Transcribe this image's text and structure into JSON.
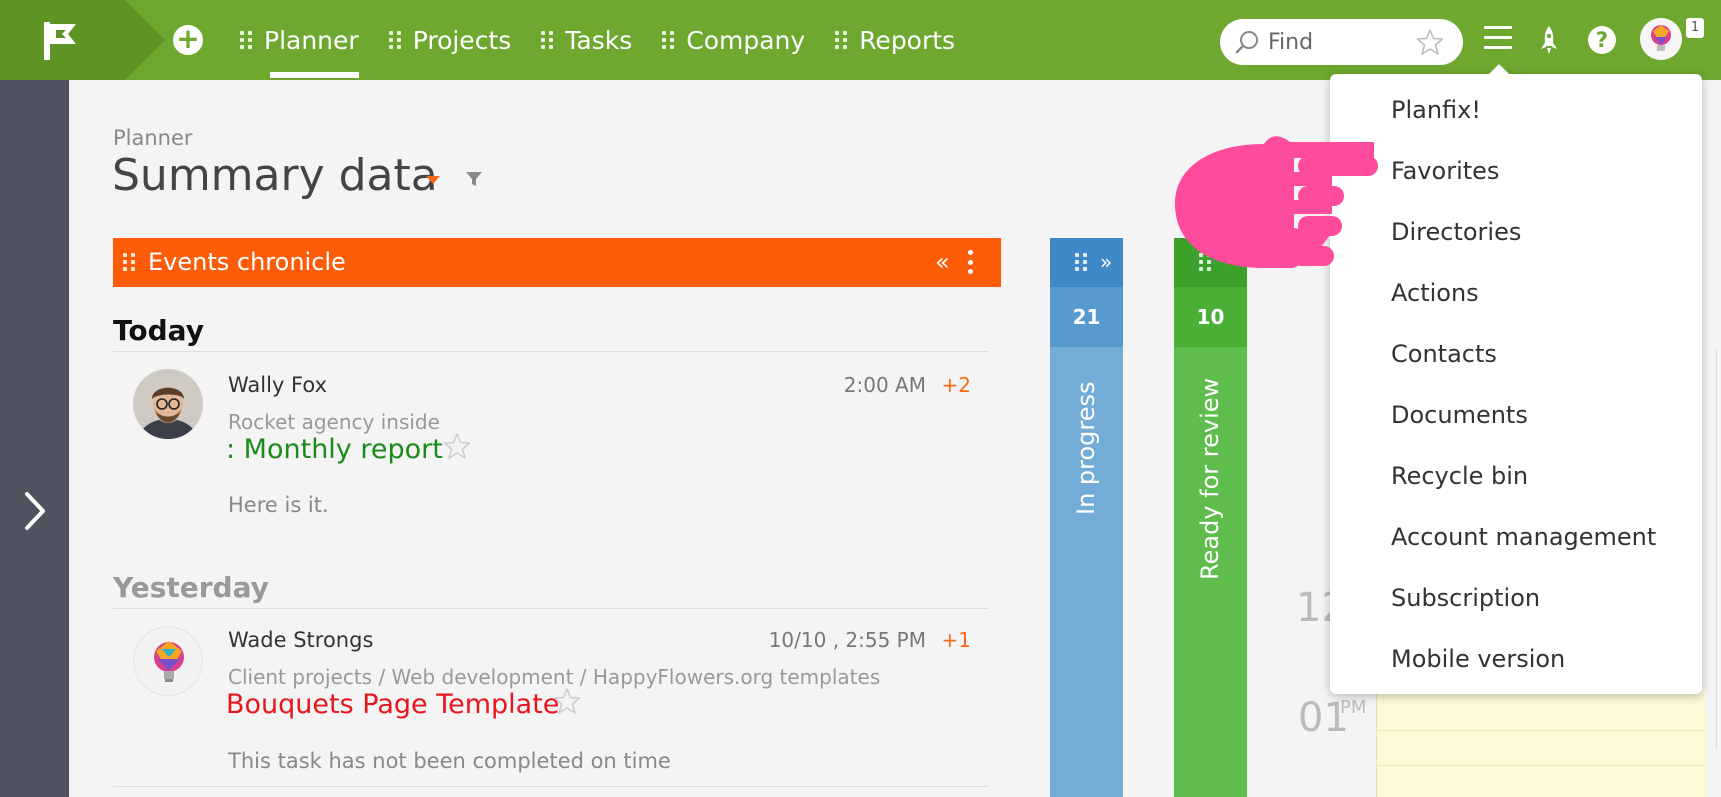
{
  "topbar": {
    "nav": [
      "Planner",
      "Projects",
      "Tasks",
      "Company",
      "Reports"
    ],
    "active_nav": "Planner",
    "search_placeholder": "Find",
    "notification_count": "1"
  },
  "page": {
    "breadcrumb": "Planner",
    "title": "Summary data"
  },
  "events_panel": {
    "title": "Events chronicle",
    "collapse_glyph": "«",
    "today_heading": "Today",
    "yesterday_heading": "Yesterday",
    "events": [
      {
        "author": "Wally Fox",
        "time": "2:00 AM",
        "plus": "+2",
        "project": "Rocket agency inside",
        "task": ": Monthly report",
        "task_color": "#1a8a1a",
        "text": "Here is it."
      },
      {
        "author": "Wade Strongs",
        "time": "10/10 , 2:55 PM",
        "plus": "+1",
        "project": "Client projects / Web development / HappyFlowers.org templates",
        "task": "Bouquets Page Template",
        "task_color": "#e8161c",
        "text": "This task has not been completed on time"
      }
    ]
  },
  "kanban": {
    "columns": [
      {
        "label": "In progress",
        "count": "21",
        "color": "#74acd8"
      },
      {
        "label": "Ready for review",
        "count": "10",
        "color": "#5fbd4d"
      }
    ],
    "expand_glyph": "»"
  },
  "calendar": {
    "time_12": "12",
    "time_01": "01",
    "pm": "PM"
  },
  "dropdown": {
    "items": [
      "Planfix!",
      "Favorites",
      "Directories",
      "Actions",
      "Contacts",
      "Documents",
      "Recycle bin",
      "Account management",
      "Subscription",
      "Mobile version"
    ]
  },
  "colors": {
    "topbar": "#6ea82f",
    "events_header": "#fd5c09",
    "side_rail": "#50535f",
    "pointer_hand": "#ff4b9b"
  }
}
